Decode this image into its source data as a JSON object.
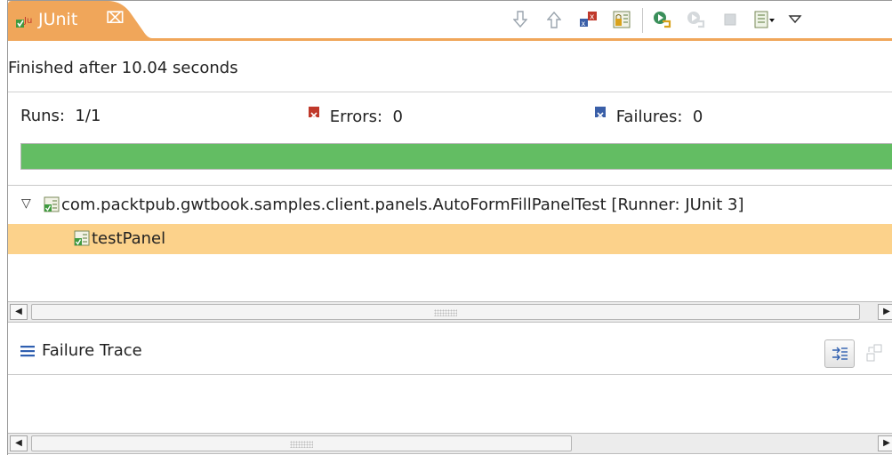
{
  "tab": {
    "title": "JUnit",
    "close_glyph": "⌧",
    "icon": "junit-icon"
  },
  "toolbar": {
    "icons": [
      "next-failure-icon",
      "previous-failure-icon",
      "show-failures-only-icon",
      "scroll-lock-icon",
      "rerun-test-icon",
      "rerun-failed-first-icon",
      "stop-icon",
      "test-run-history-icon",
      "view-menu-icon"
    ]
  },
  "status": {
    "text": "Finished after 10.04 seconds"
  },
  "counters": {
    "runs_label": "Runs:",
    "runs_value": "1/1",
    "errors_label": "Errors:",
    "errors_value": "0",
    "failures_label": "Failures:",
    "failures_value": "0"
  },
  "progress": {
    "fraction": 1.0,
    "color": "#63bd63"
  },
  "tree": {
    "suite": {
      "label": "com.packtpub.gwtbook.samples.client.panels.AutoFormFillPanelTest [Runner: JUnit 3]",
      "expanded": true
    },
    "tests": [
      {
        "label": "testPanel",
        "selected": true
      }
    ]
  },
  "trace": {
    "title": "Failure Trace"
  }
}
